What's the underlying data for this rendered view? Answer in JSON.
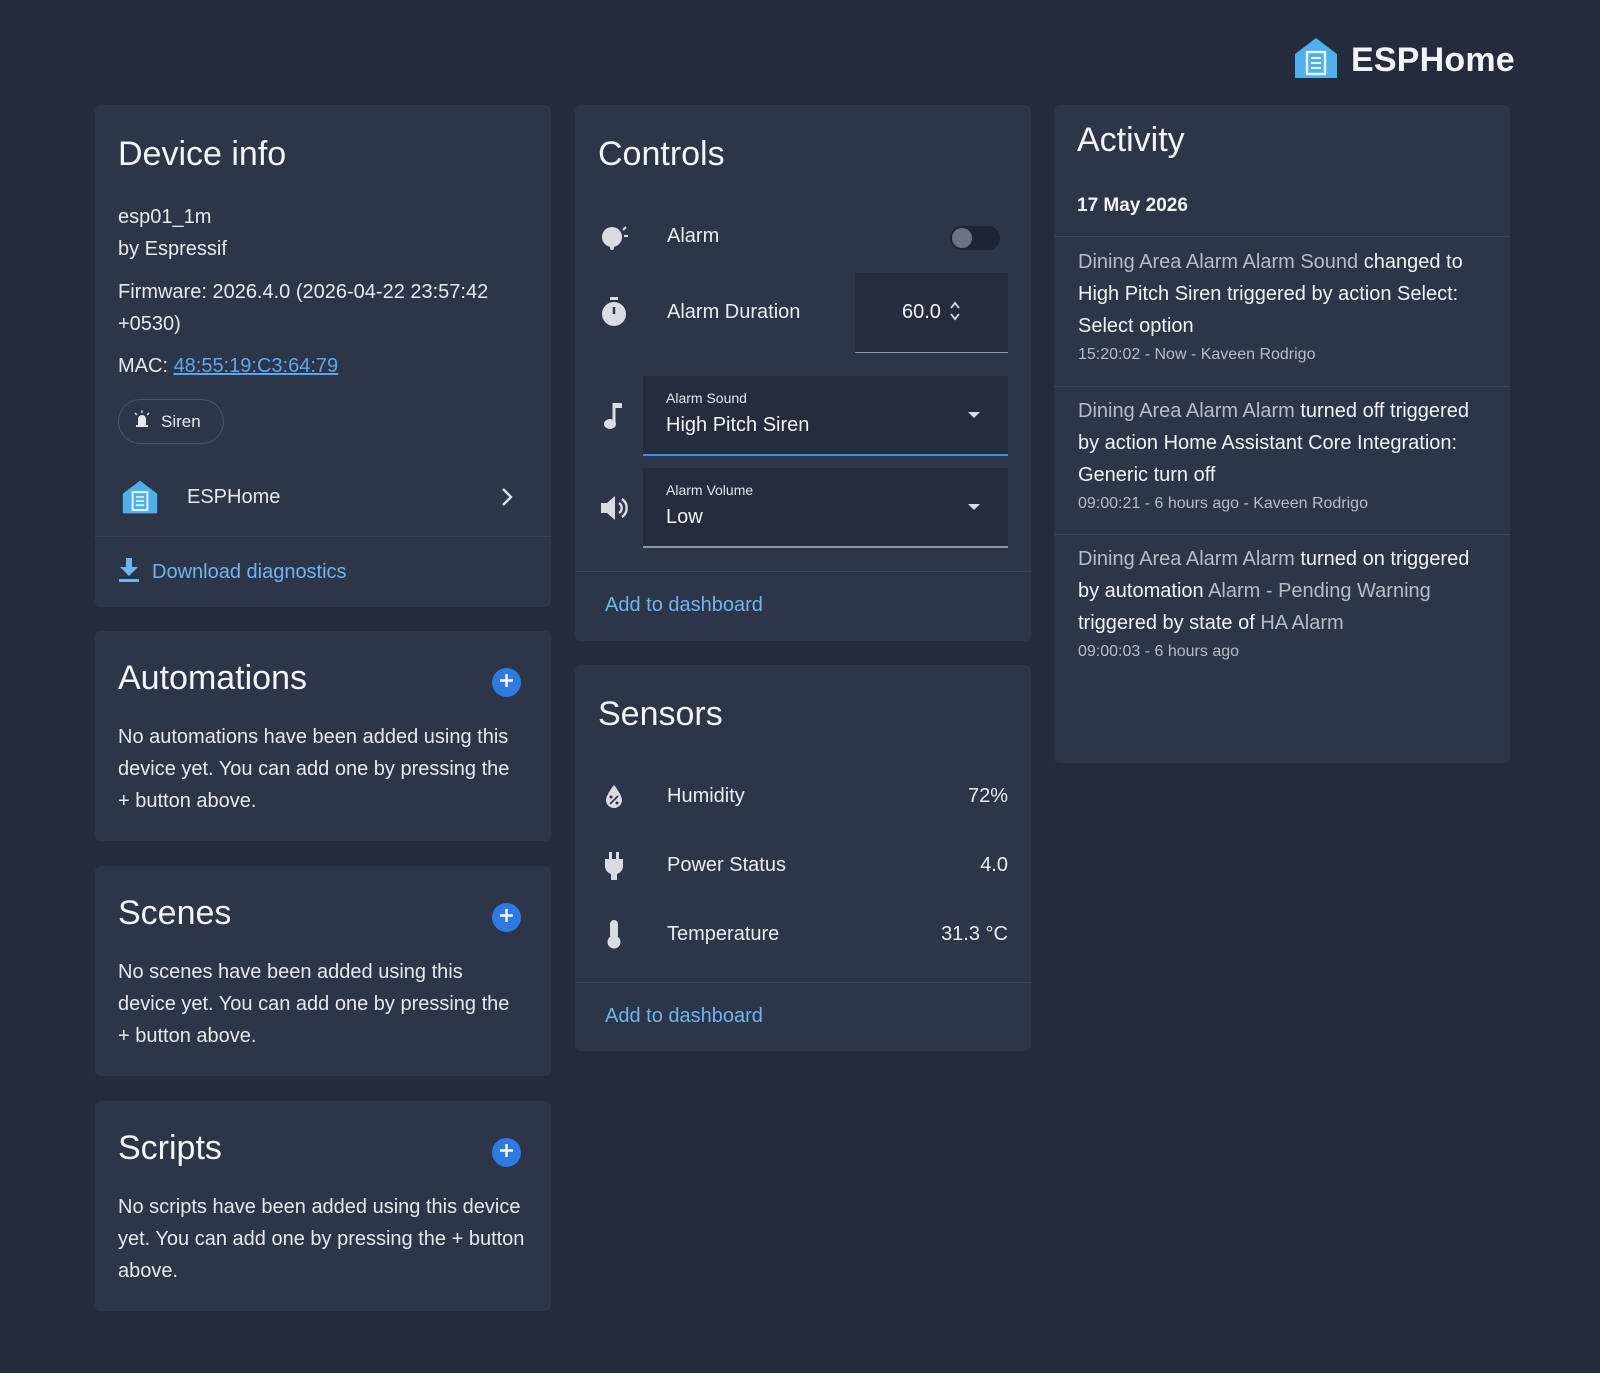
{
  "brand": {
    "name": "ESPHome",
    "icon": "esphome-house-icon",
    "color": "#4fb0ea"
  },
  "device_info": {
    "title": "Device info",
    "model": "esp01_1m",
    "manufacturer": "by Espressif",
    "firmware": "Firmware: 2026.4.0 (2026-04-22 23:57:42 +0530)",
    "mac_label": "MAC:",
    "mac_value": "48:55:19:C3:64:79",
    "chip_label": "Siren",
    "integration_label": "ESPHome",
    "download_label": "Download diagnostics"
  },
  "automations": {
    "title": "Automations",
    "body": "No automations have been added using this device yet. You can add one by pressing the + button above."
  },
  "scenes": {
    "title": "Scenes",
    "body": "No scenes have been added using this device yet. You can add one by pressing the + button above."
  },
  "scripts": {
    "title": "Scripts",
    "body": "No scripts have been added using this device yet. You can add one by pressing the + button above."
  },
  "controls": {
    "title": "Controls",
    "alarm_label": "Alarm",
    "alarm_duration_label": "Alarm Duration",
    "alarm_duration_value": "60.0",
    "alarm_sound_label": "Alarm Sound",
    "alarm_sound_value": "High Pitch Siren",
    "alarm_volume_label": "Alarm Volume",
    "alarm_volume_value": "Low",
    "add_label": "Add to dashboard"
  },
  "sensors": {
    "title": "Sensors",
    "items": [
      {
        "label": "Humidity",
        "value": "72%"
      },
      {
        "label": "Power Status",
        "value": "4.0"
      },
      {
        "label": "Temperature",
        "value": "31.3 °C"
      }
    ],
    "add_label": "Add to dashboard"
  },
  "activity": {
    "title": "Activity",
    "date": "17 May 2026",
    "entries": [
      {
        "entity": "Dining Area Alarm Alarm Sound",
        "text": " changed to High Pitch Siren triggered by action Select: Select option",
        "meta": "15:20:02 - Now - Kaveen Rodrigo"
      },
      {
        "entity": "Dining Area Alarm Alarm",
        "text": " turned off triggered by action Home Assistant Core Integration: Generic turn off",
        "meta": "09:00:21 - 6 hours ago - Kaveen Rodrigo"
      },
      {
        "entity": "Dining Area Alarm Alarm",
        "text": " turned on triggered by automation ",
        "automation": "Alarm - Pending Warning",
        "text2": " triggered by state of ",
        "state_entity": "HA Alarm",
        "meta": "09:00:03 - 6 hours ago"
      }
    ]
  }
}
